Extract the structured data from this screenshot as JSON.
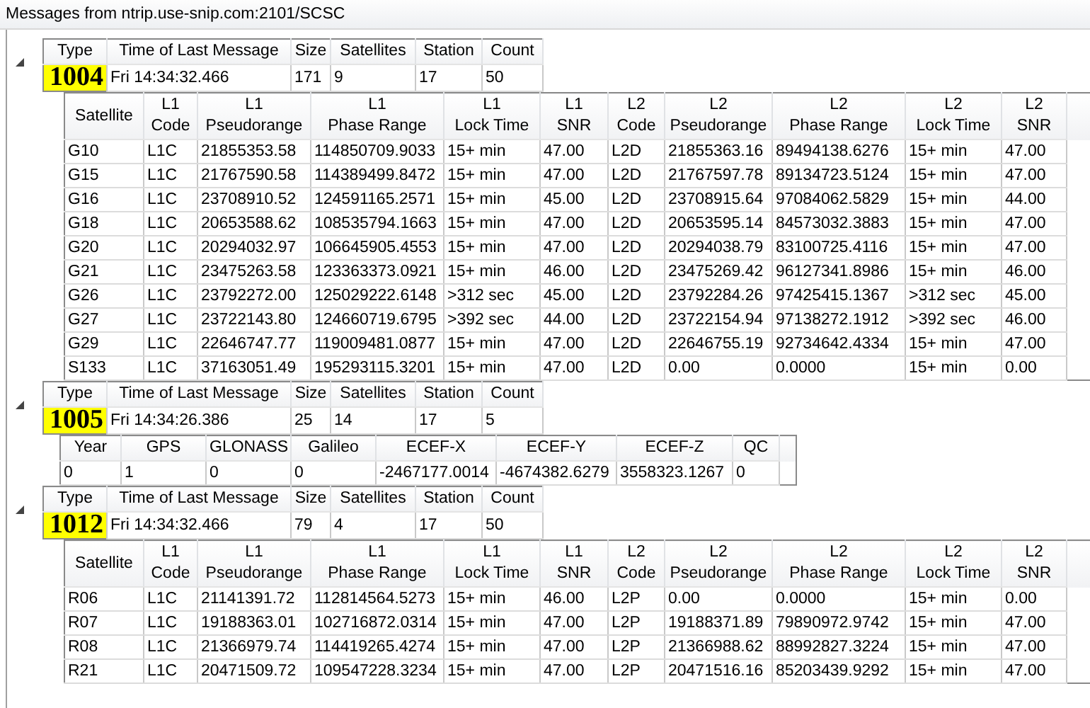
{
  "window": {
    "title": "Messages from ntrip.use-snip.com:2101/SCSC"
  },
  "messages": [
    {
      "expanded": true,
      "header": {
        "columns": [
          "Type",
          "Time of Last Message",
          "Size",
          "Satellites",
          "Station",
          "Count"
        ],
        "values": [
          "1004",
          "Fri 14:34:32.466",
          "171",
          "9",
          "17",
          "50"
        ]
      },
      "detail": {
        "kind": "observations",
        "columns": [
          "Satellite",
          "L1\nCode",
          "L1\nPseudorange",
          "L1\nPhase Range",
          "L1\nLock Time",
          "L1\nSNR",
          "L2\nCode",
          "L2\nPseudorange",
          "L2\nPhase Range",
          "L2\nLock Time",
          "L2\nSNR"
        ],
        "rows": [
          [
            "G10",
            "L1C",
            "21855353.58",
            "114850709.9033",
            "15+ min",
            "47.00",
            "L2D",
            "21855363.16",
            "89494138.6276",
            "15+ min",
            "47.00"
          ],
          [
            "G15",
            "L1C",
            "21767590.58",
            "114389499.8472",
            "15+ min",
            "47.00",
            "L2D",
            "21767597.78",
            "89134723.5124",
            "15+ min",
            "47.00"
          ],
          [
            "G16",
            "L1C",
            "23708910.52",
            "124591165.2571",
            "15+ min",
            "45.00",
            "L2D",
            "23708915.64",
            "97084062.5829",
            "15+ min",
            "44.00"
          ],
          [
            "G18",
            "L1C",
            "20653588.62",
            "108535794.1663",
            "15+ min",
            "47.00",
            "L2D",
            "20653595.14",
            "84573032.3883",
            "15+ min",
            "47.00"
          ],
          [
            "G20",
            "L1C",
            "20294032.97",
            "106645905.4553",
            "15+ min",
            "47.00",
            "L2D",
            "20294038.79",
            "83100725.4116",
            "15+ min",
            "47.00"
          ],
          [
            "G21",
            "L1C",
            "23475263.58",
            "123363373.0921",
            "15+ min",
            "46.00",
            "L2D",
            "23475269.42",
            "96127341.8986",
            "15+ min",
            "46.00"
          ],
          [
            "G26",
            "L1C",
            "23792272.00",
            "125029222.6148",
            ">312 sec",
            "45.00",
            "L2D",
            "23792284.26",
            "97425415.1367",
            ">312 sec",
            "45.00"
          ],
          [
            "G27",
            "L1C",
            "23722143.80",
            "124660719.6795",
            ">392 sec",
            "44.00",
            "L2D",
            "23722154.94",
            "97138272.1912",
            ">392 sec",
            "46.00"
          ],
          [
            "G29",
            "L1C",
            "22646747.77",
            "119009481.0877",
            "15+ min",
            "47.00",
            "L2D",
            "22646755.19",
            "92734642.4334",
            "15+ min",
            "47.00"
          ],
          [
            "S133",
            "L1C",
            "37163051.49",
            "195293115.3201",
            "15+ min",
            "47.00",
            "L2D",
            "0.00",
            "0.0000",
            "15+ min",
            "0.00"
          ]
        ]
      }
    },
    {
      "expanded": true,
      "header": {
        "columns": [
          "Type",
          "Time of Last Message",
          "Size",
          "Satellites",
          "Station",
          "Count"
        ],
        "values": [
          "1005",
          "Fri 14:34:26.386",
          "25",
          "14",
          "17",
          "5"
        ]
      },
      "detail": {
        "kind": "station",
        "columns": [
          "Year",
          "GPS",
          "GLONASS",
          "Galileo",
          "ECEF-X",
          "ECEF-Y",
          "ECEF-Z",
          "QC"
        ],
        "rows": [
          [
            "0",
            "1",
            "0",
            "0",
            "-2467177.0014",
            "-4674382.6279",
            "3558323.1267",
            "0"
          ]
        ]
      }
    },
    {
      "expanded": true,
      "header": {
        "columns": [
          "Type",
          "Time of Last Message",
          "Size",
          "Satellites",
          "Station",
          "Count"
        ],
        "values": [
          "1012",
          "Fri 14:34:32.466",
          "79",
          "4",
          "17",
          "50"
        ]
      },
      "detail": {
        "kind": "observations",
        "columns": [
          "Satellite",
          "L1\nCode",
          "L1\nPseudorange",
          "L1\nPhase Range",
          "L1\nLock Time",
          "L1\nSNR",
          "L2\nCode",
          "L2\nPseudorange",
          "L2\nPhase Range",
          "L2\nLock Time",
          "L2\nSNR"
        ],
        "rows": [
          [
            "R06",
            "L1C",
            "21141391.72",
            "112814564.5273",
            "15+ min",
            "46.00",
            "L2P",
            "0.00",
            "0.0000",
            "15+ min",
            "0.00"
          ],
          [
            "R07",
            "L1C",
            "19188363.01",
            "102716872.0314",
            "15+ min",
            "47.00",
            "L2P",
            "19188371.89",
            "79890972.9742",
            "15+ min",
            "47.00"
          ],
          [
            "R08",
            "L1C",
            "21366979.74",
            "114419265.4274",
            "15+ min",
            "47.00",
            "L2P",
            "21366988.62",
            "88992827.3224",
            "15+ min",
            "47.00"
          ],
          [
            "R21",
            "L1C",
            "20471509.72",
            "109547228.3234",
            "15+ min",
            "47.00",
            "L2P",
            "20471516.16",
            "85203439.9292",
            "15+ min",
            "47.00"
          ]
        ]
      }
    }
  ]
}
